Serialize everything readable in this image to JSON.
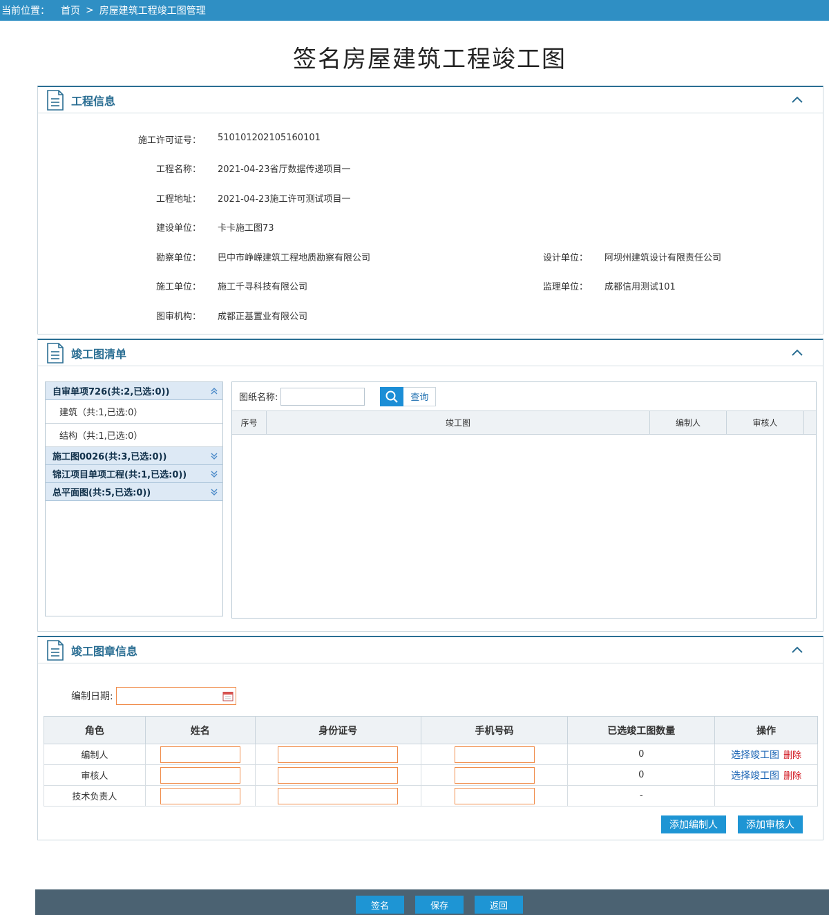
{
  "breadcrumb": {
    "prefix": "当前位置：",
    "home": "首页",
    "sep": ">",
    "current": "房屋建筑工程竣工图管理"
  },
  "page_title": "签名房屋建筑工程竣工图",
  "project_section": {
    "title": "工程信息",
    "fields": {
      "permit_label": "施工许可证号：",
      "permit_value": "510101202105160101",
      "name_label": "工程名称：",
      "name_value": "2021-04-23省厅数据传递项目一",
      "address_label": "工程地址：",
      "address_value": "2021-04-23施工许可测试项目一",
      "builder_label": "建设单位：",
      "builder_value": "卡卡施工图73",
      "survey_label": "勘察单位：",
      "survey_value": "巴中市峥嵘建筑工程地质勘察有限公司",
      "design_label": "设计单位：",
      "design_value": "阿坝州建筑设计有限责任公司",
      "construction_label": "施工单位：",
      "construction_value": "施工千寻科技有限公司",
      "supervision_label": "监理单位：",
      "supervision_value": "成都信用测试101",
      "review_label": "图审机构：",
      "review_value": "成都正基置业有限公司"
    }
  },
  "drawing_section": {
    "title": "竣工图清单",
    "tree": {
      "group1": "自审单项726(共:2,已选:0))",
      "item1": "建筑（共:1,已选:0）",
      "item2": "结构（共:1,已选:0）",
      "group2": "施工图0026(共:3,已选:0))",
      "group3": "锦江项目单项工程(共:1,已选:0))",
      "group4": "总平面图(共:5,已选:0))"
    },
    "search_label": "图纸名称:",
    "query_label": "查询",
    "columns": {
      "index": "序号",
      "drawing": "竣工图",
      "editor": "编制人",
      "reviewer": "审核人"
    }
  },
  "seal_section": {
    "title": "竣工图章信息",
    "date_label": "编制日期:",
    "columns": {
      "role": "角色",
      "name": "姓名",
      "id": "身份证号",
      "phone": "手机号码",
      "count": "已选竣工图数量",
      "action": "操作"
    },
    "rows": [
      {
        "role": "编制人",
        "count": "0",
        "select": "选择竣工图",
        "delete": "删除"
      },
      {
        "role": "审核人",
        "count": "0",
        "select": "选择竣工图",
        "delete": "删除"
      },
      {
        "role": "技术负责人",
        "count": "-"
      }
    ],
    "add_editor": "添加编制人",
    "add_reviewer": "添加审核人"
  },
  "footer": {
    "sign": "签名",
    "save": "保存",
    "back": "返回"
  },
  "colors": {
    "topbar": "#2f8fc4",
    "section_border": "#2a6e93",
    "button": "#1e95d4",
    "input_border": "#f08c4a",
    "footer": "#4b6272"
  }
}
